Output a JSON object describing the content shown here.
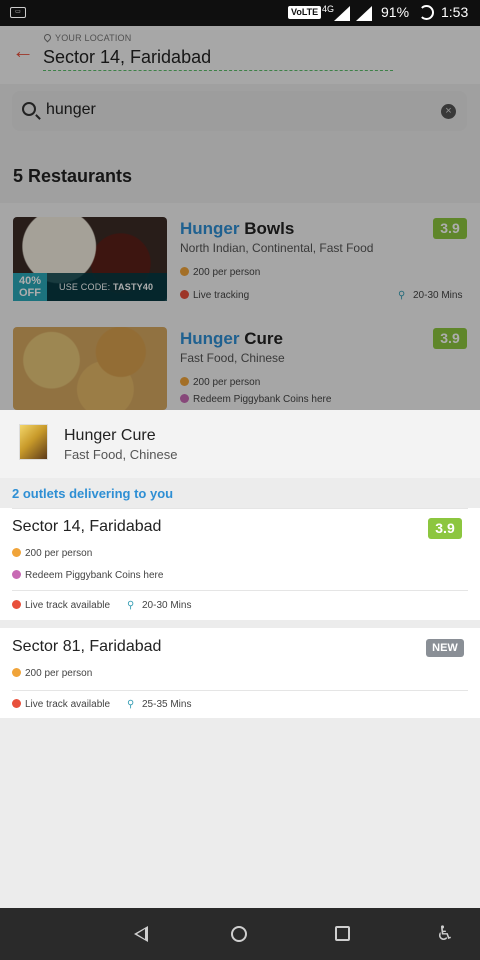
{
  "status_bar": {
    "volte": "VoLTE",
    "network": "4G",
    "battery": "91%",
    "time": "1:53"
  },
  "header": {
    "caption": "YOUR LOCATION",
    "location": "Sector 14, Faridabad"
  },
  "search": {
    "query": "hunger"
  },
  "results": {
    "title": "5 Restaurants"
  },
  "restaurants": [
    {
      "name_highlight": "Hunger",
      "name_rest": " Bowls",
      "cuisine": "North Indian, Continental, Fast Food",
      "rating": "3.9",
      "price": "200 per person",
      "tracking": "Live tracking",
      "delivery_time": "20-30 Mins",
      "offer_percent": "40%",
      "offer_off": "OFF",
      "offer_code_prefix": "USE CODE: ",
      "offer_code": "TASTY40"
    },
    {
      "name_highlight": "Hunger",
      "name_rest": " Cure",
      "cuisine": "Fast Food, Chinese",
      "rating": "3.9",
      "price": "200 per person",
      "promo": "Redeem Piggybank Coins here"
    }
  ],
  "sheet": {
    "title": "Hunger Cure",
    "subtitle": "Fast Food, Chinese",
    "outlets_label": "2 outlets delivering to you",
    "outlets": [
      {
        "name": "Sector 14, Faridabad",
        "rating": "3.9",
        "price": "200 per person",
        "promo": "Redeem Piggybank Coins here",
        "tracking": "Live track available",
        "delivery_time": "20-30 Mins"
      },
      {
        "name": "Sector 81, Faridabad",
        "badge": "NEW",
        "price": "200 per person",
        "tracking": "Live track available",
        "delivery_time": "25-35 Mins"
      }
    ]
  },
  "colors": {
    "accent": "#e8503c",
    "brand_blue": "#2e8fd4",
    "rating_green": "#8cc63f",
    "new_badge": "#8a8f96"
  },
  "icons": [
    "back-arrow-icon",
    "location-pin-icon",
    "search-icon",
    "clear-icon",
    "coin-icon",
    "piggybank-icon",
    "live-track-icon",
    "bike-icon",
    "nav-back-icon",
    "nav-home-icon",
    "nav-recents-icon",
    "accessibility-icon"
  ]
}
